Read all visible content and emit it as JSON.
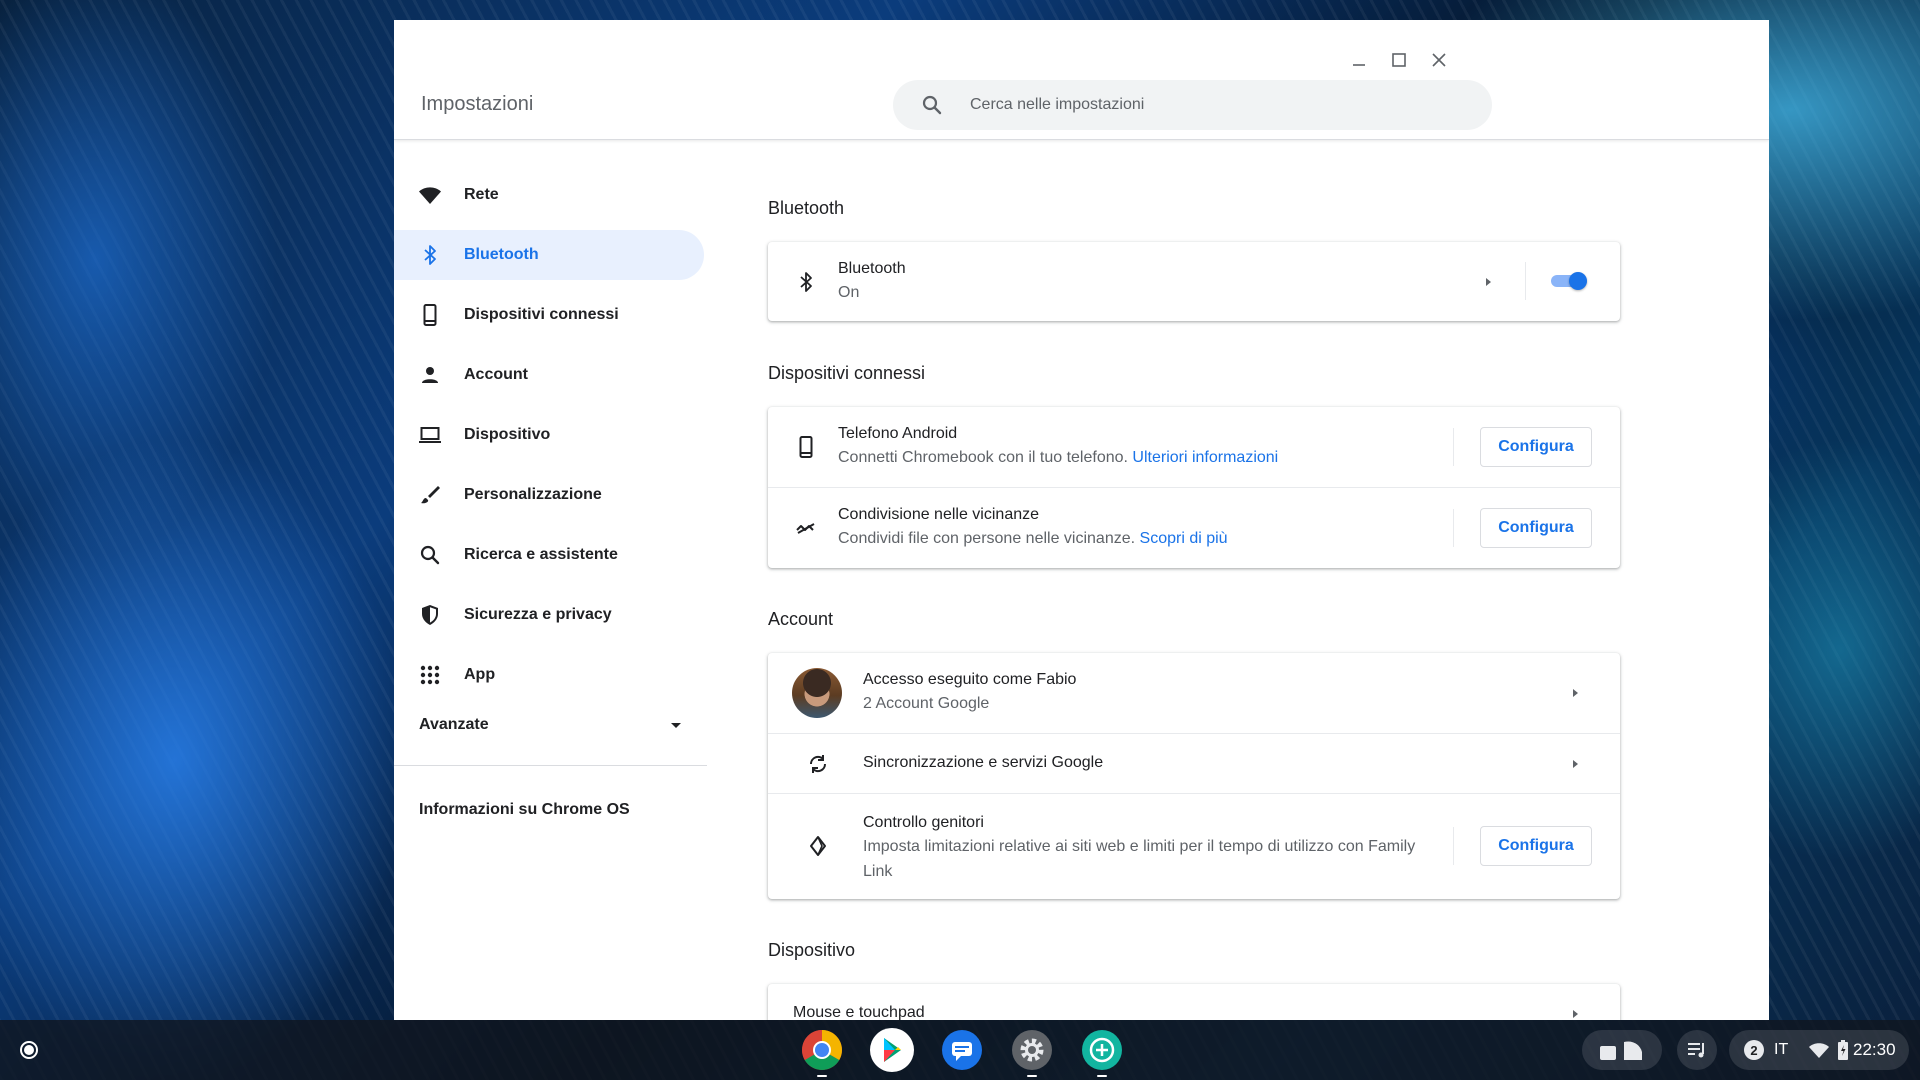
{
  "window": {
    "title": "Impostazioni",
    "search_placeholder": "Cerca nelle impostazioni",
    "controls": [
      "minimize-icon",
      "maximize-icon",
      "close-icon"
    ]
  },
  "sidebar": {
    "items": [
      {
        "label": "Rete",
        "icon": "wifi-icon"
      },
      {
        "label": "Bluetooth",
        "icon": "bluetooth-icon",
        "active": true
      },
      {
        "label": "Dispositivi connessi",
        "icon": "phone-icon"
      },
      {
        "label": "Account",
        "icon": "person-icon"
      },
      {
        "label": "Dispositivo",
        "icon": "laptop-icon"
      },
      {
        "label": "Personalizzazione",
        "icon": "brush-icon"
      },
      {
        "label": "Ricerca e assistente",
        "icon": "search-icon"
      },
      {
        "label": "Sicurezza e privacy",
        "icon": "shield-icon"
      },
      {
        "label": "App",
        "icon": "apps-grid-icon"
      }
    ],
    "advanced_label": "Avanzate",
    "about_label": "Informazioni su Chrome OS"
  },
  "main": {
    "bluetooth": {
      "section_title": "Bluetooth",
      "title": "Bluetooth",
      "status": "On",
      "enabled": true
    },
    "connected_devices": {
      "section_title": "Dispositivi connessi",
      "android": {
        "title": "Telefono Android",
        "subtitle": "Connetti Chromebook con il tuo telefono.",
        "link": "Ulteriori informazioni",
        "button": "Configura"
      },
      "nearby": {
        "title": "Condivisione nelle vicinanze",
        "subtitle": "Condividi file con persone nelle vicinanze.",
        "link": "Scopri di più",
        "button": "Configura"
      }
    },
    "account": {
      "section_title": "Account",
      "signed_in": {
        "title": "Accesso eseguito come Fabio",
        "subtitle": "2 Account Google"
      },
      "sync": {
        "title": "Sincronizzazione e servizi Google"
      },
      "parental": {
        "title": "Controllo genitori",
        "subtitle": "Imposta limitazioni relative ai siti web e limiti per il tempo di utilizzo con Family Link",
        "button": "Configura"
      }
    },
    "device": {
      "section_title": "Dispositivo",
      "mouse": {
        "title": "Mouse e touchpad"
      }
    }
  },
  "shelf": {
    "apps": [
      "chrome-icon",
      "play-store-icon",
      "messages-icon",
      "settings-icon",
      "add-app-icon"
    ],
    "notification_count": "2",
    "language": "IT",
    "time": "22:30"
  }
}
